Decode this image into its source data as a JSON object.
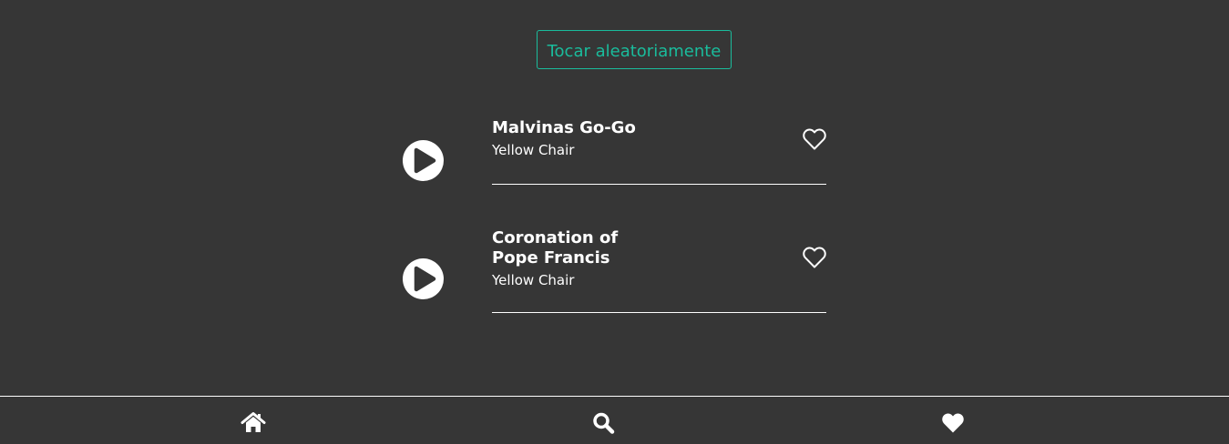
{
  "shuffle": {
    "label": "Tocar aleatoriamente"
  },
  "tracks": [
    {
      "title": "Malvinas Go-Go",
      "artist": "Yellow Chair",
      "favorite": false,
      "play_icon": "play-circle-icon",
      "favorite_icon": "heart-outline-icon"
    },
    {
      "title": "Coronation of Pope Francis",
      "artist": "Yellow Chair",
      "favorite": false,
      "play_icon": "play-circle-icon",
      "favorite_icon": "heart-outline-icon"
    }
  ],
  "nav": {
    "items": [
      {
        "icon": "home-icon"
      },
      {
        "icon": "search-icon"
      },
      {
        "icon": "heart-icon"
      }
    ]
  },
  "colors": {
    "background": "#363636",
    "accent": "#1abc9c",
    "foreground": "#ffffff"
  }
}
